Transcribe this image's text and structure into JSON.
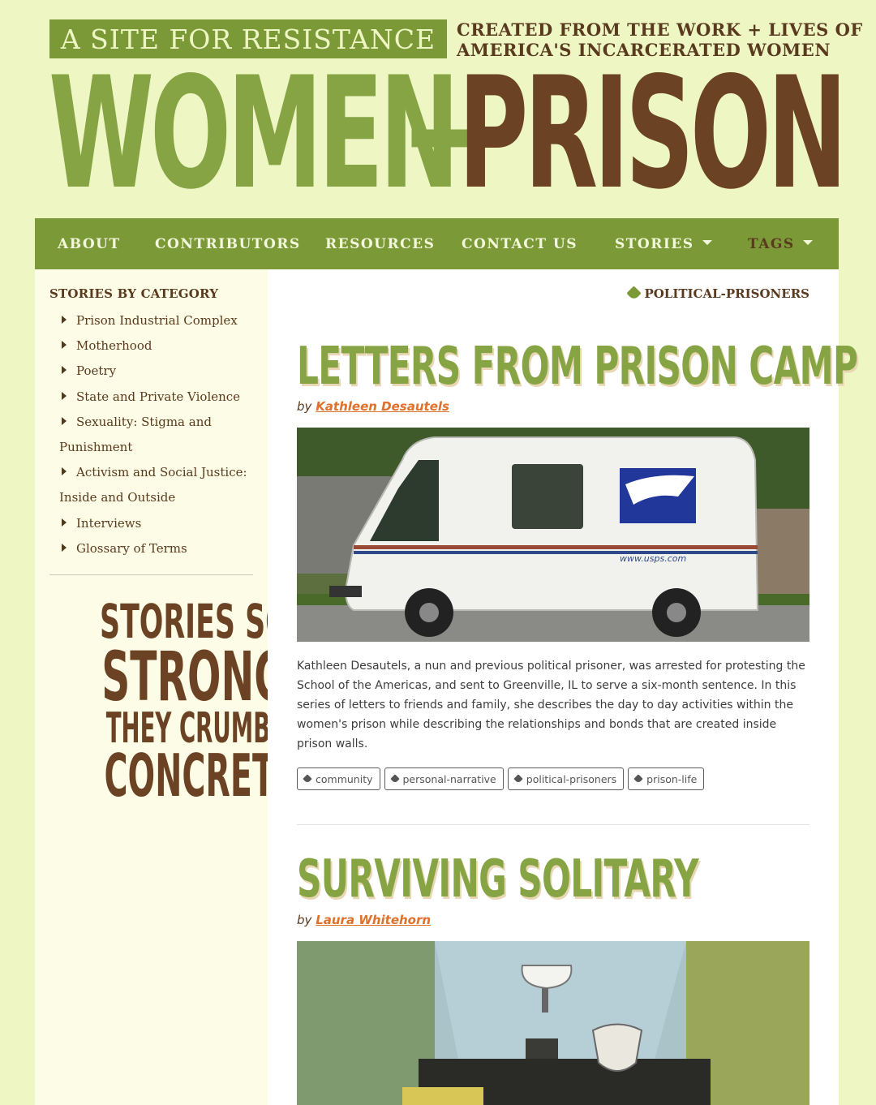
{
  "header": {
    "tagline": "A SITE FOR RESISTANCE",
    "created_line1": "CREATED FROM THE WORK + LIVES OF",
    "created_line2": "AMERICA'S INCARCERATED WOMEN",
    "logo_left": "WOMEN",
    "logo_plus": "+",
    "logo_right": "PRISON"
  },
  "nav": {
    "about": "ABOUT",
    "contributors": "CONTRIBUTORS",
    "resources": "RESOURCES",
    "contact": "CONTACT US",
    "stories": "STORIES",
    "tags": "TAGS"
  },
  "sidebar": {
    "title": "STORIES BY CATEGORY",
    "items": [
      {
        "label": "Prison Industrial Complex"
      },
      {
        "label": "Motherhood"
      },
      {
        "label": "Poetry"
      },
      {
        "label": "State and Private Violence"
      },
      {
        "label": "Sexuality: Stigma and Punishment"
      },
      {
        "label": "Activism and Social Justice: Inside and Outside"
      },
      {
        "label": "Interviews"
      },
      {
        "label": "Glossary of Terms"
      }
    ],
    "slogan": {
      "line1": "STORIES SO",
      "line2": "STRONG",
      "line3": "THEY CRUMBLE",
      "line4": "CONCRETE"
    }
  },
  "main": {
    "category_tag": "POLITICAL-PRISONERS",
    "posts": [
      {
        "title": "LETTERS FROM PRISON CAMP",
        "by": "by",
        "author": "Kathleen Desautels",
        "image_label": "www.usps.com",
        "excerpt": "Kathleen Desautels, a nun and previous political prisoner, was arrested for protesting the School of the Americas, and sent to Greenville, IL to serve a six-month sentence. In this series of letters to friends and family, she describes the day to day activities within the women's prison while describing the relationships and bonds that are created inside prison walls.",
        "tags": [
          "community",
          "personal-narrative",
          "political-prisoners",
          "prison-life"
        ]
      },
      {
        "title": "SURVIVING SOLITARY",
        "by": "by",
        "author": "Laura Whitehorn"
      }
    ]
  },
  "colors": {
    "page_bg": "#eef7c4",
    "green": "#7b9a37",
    "brown": "#5a3a1e",
    "link_orange": "#e0712a"
  }
}
